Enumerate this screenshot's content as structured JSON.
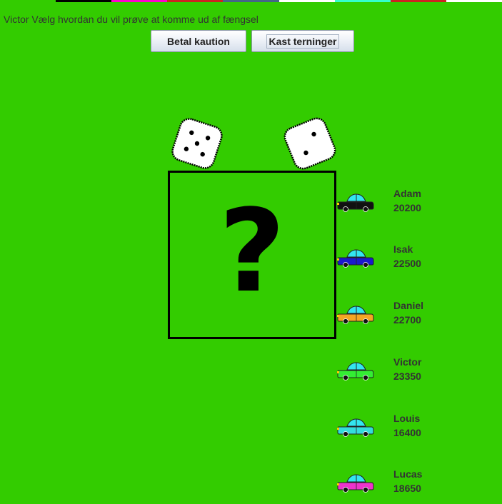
{
  "colors": {
    "background": "#33cc00",
    "top_strip": [
      "#33cc00",
      "#000000",
      "#ff00cc",
      "#cc2222",
      "#446688",
      "#ffffff",
      "#33ffcc",
      "#cc2222",
      "#ffffff"
    ]
  },
  "message": "Victor Vælg hvordan du vil prøve at komme ud af fængsel",
  "buttons": {
    "bail": "Betal kaution",
    "roll": "Kast terninger"
  },
  "dice": [
    {
      "value": 5
    },
    {
      "value": 2
    }
  ],
  "card": {
    "symbol": "?"
  },
  "players": [
    {
      "name": "Adam",
      "money": "20200",
      "car_color": "#111111"
    },
    {
      "name": "Isak",
      "money": "22500",
      "car_color": "#1a1acc"
    },
    {
      "name": "Daniel",
      "money": "22700",
      "car_color": "#f5a623"
    },
    {
      "name": "Victor",
      "money": "23350",
      "car_color": "#33ee33"
    },
    {
      "name": "Louis",
      "money": "16400",
      "car_color": "#33dddd"
    },
    {
      "name": "Lucas",
      "money": "18650",
      "car_color": "#ee33cc"
    }
  ]
}
